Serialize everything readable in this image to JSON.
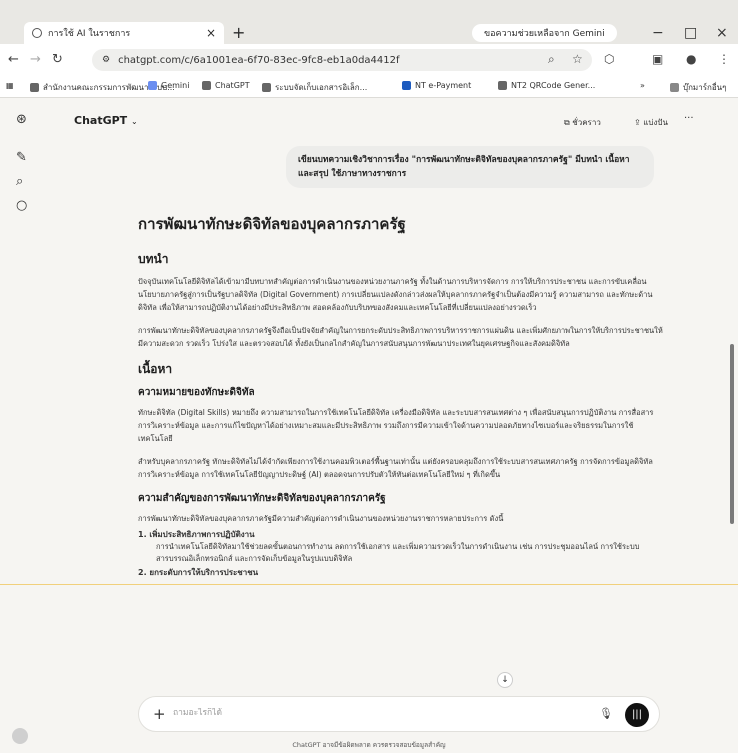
{
  "browser": {
    "tab_title": "การใช้ AI ในราชการ",
    "gemini_pill": "ขอความช่วยเหลือจาก Gemini",
    "url": "chatgpt.com/c/6a1001ea-6f70-83ec-9fc8-eb1a0da4412f",
    "bookmarks": [
      "สำนักงานคณะกรรมการพัฒนาระบบ...",
      "Gemini",
      "ChatGPT",
      "ระบบจัดเก็บเอกสารอิเล็ก...",
      "NT e-Payment",
      "NT2 QRCode Gener...",
      "บุ๊กมาร์กอื่นๆ"
    ],
    "more_label": "»"
  },
  "chat": {
    "model_label": "ChatGPT",
    "share_label": "แบ่งปัน",
    "temp_label": "ชั่วคราว",
    "user_message": "เขียนบทความเชิงวิชาการเรื่อง \"การพัฒนาทักษะดิจิทัลของบุคลากรภาครัฐ\" มีบทนำ เนื้อหา และสรุป ใช้ภาษาทางราชการ",
    "composer_placeholder": "ถามอะไรก็ได้",
    "footer": "ChatGPT อาจมีข้อผิดพลาด ควรตรวจสอบข้อมูลสำคัญ"
  },
  "article": {
    "title": "การพัฒนาทักษะดิจิทัลของบุคลากรภาครัฐ",
    "intro_heading": "บทนำ",
    "intro_p1": "ปัจจุบันเทคโนโลยีดิจิทัลได้เข้ามามีบทบาทสำคัญต่อการดำเนินงานของหน่วยงานภาครัฐ ทั้งในด้านการบริหารจัดการ การให้บริการประชาชน และการขับเคลื่อนนโยบายภาครัฐสู่การเป็นรัฐบาลดิจิทัล (Digital Government) การเปลี่ยนแปลงดังกล่าวส่งผลให้บุคลากรภาครัฐจำเป็นต้องมีความรู้ ความสามารถ และทักษะด้านดิจิทัล เพื่อให้สามารถปฏิบัติงานได้อย่างมีประสิทธิภาพ สอดคล้องกับบริบทของสังคมและเทคโนโลยีที่เปลี่ยนแปลงอย่างรวดเร็ว",
    "intro_p2": "การพัฒนาทักษะดิจิทัลของบุคลากรภาครัฐจึงถือเป็นปัจจัยสำคัญในการยกระดับประสิทธิภาพการบริหารราชการแผ่นดิน และเพิ่มศักยภาพในการให้บริการประชาชนให้มีความสะดวก รวดเร็ว โปร่งใส และตรวจสอบได้ ทั้งยังเป็นกลไกสำคัญในการสนับสนุนการพัฒนาประเทศในยุคเศรษฐกิจและสังคมดิจิทัล",
    "body_heading": "เนื้อหา",
    "meaning_heading": "ความหมายของทักษะดิจิทัล",
    "meaning_p1": "ทักษะดิจิทัล (Digital Skills) หมายถึง ความสามารถในการใช้เทคโนโลยีดิจิทัล เครื่องมือดิจิทัล และระบบสารสนเทศต่าง ๆ เพื่อสนับสนุนการปฏิบัติงาน การสื่อสาร การวิเคราะห์ข้อมูล และการแก้ไขปัญหาได้อย่างเหมาะสมและมีประสิทธิภาพ รวมถึงการมีความเข้าใจด้านความปลอดภัยทางไซเบอร์และจริยธรรมในการใช้เทคโนโลยี",
    "meaning_p2": "สำหรับบุคลากรภาครัฐ ทักษะดิจิทัลไม่ได้จำกัดเพียงการใช้งานคอมพิวเตอร์พื้นฐานเท่านั้น แต่ยังครอบคลุมถึงการใช้ระบบสารสนเทศภาครัฐ การจัดการข้อมูลดิจิทัล การวิเคราะห์ข้อมูล การใช้เทคโนโลยีปัญญาประดิษฐ์ (AI) ตลอดจนการปรับตัวให้ทันต่อเทคโนโลยีใหม่ ๆ ที่เกิดขึ้น",
    "importance_heading": "ความสำคัญของการพัฒนาทักษะดิจิทัลของบุคลากรภาครัฐ",
    "importance_p": "การพัฒนาทักษะดิจิทัลของบุคลากรภาครัฐมีความสำคัญต่อการดำเนินงานของหน่วยงานราชการหลายประการ ดังนี้",
    "items": [
      {
        "label": "1. เพิ่มประสิทธิภาพการปฏิบัติงาน",
        "detail": "การนำเทคโนโลยีดิจิทัลมาใช้ช่วยลดขั้นตอนการทำงาน ลดการใช้เอกสาร และเพิ่มความรวดเร็วในการดำเนินงาน เช่น การประชุมออนไลน์ การใช้ระบบสารบรรณอิเล็กทรอนิกส์ และการจัดเก็บข้อมูลในรูปแบบดิจิทัล"
      },
      {
        "label": "2. ยกระดับการให้บริการประชาชน",
        "detail": ""
      }
    ]
  }
}
